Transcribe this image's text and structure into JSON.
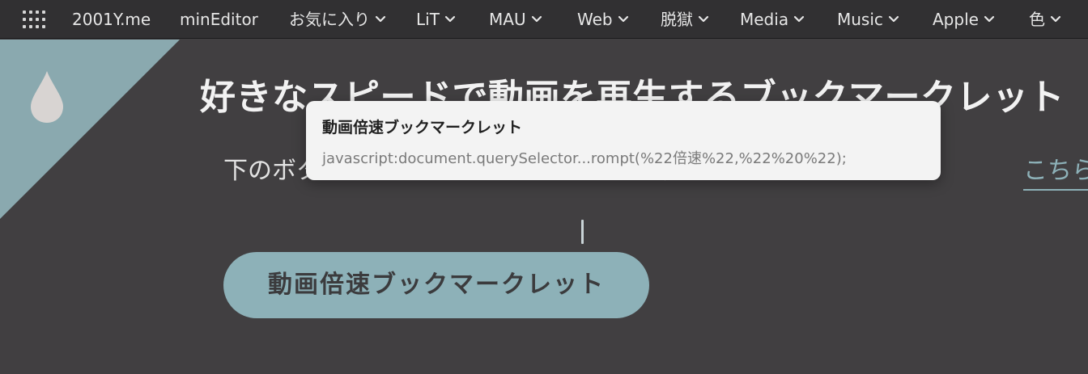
{
  "navbar": {
    "items": [
      {
        "label": "2001Y.me",
        "has_menu": false
      },
      {
        "label": "minEditor",
        "has_menu": false
      },
      {
        "label": "お気に入り",
        "has_menu": true
      },
      {
        "label": "LiT",
        "has_menu": true
      },
      {
        "label": "MAU",
        "has_menu": true
      },
      {
        "label": "Web",
        "has_menu": true
      },
      {
        "label": "脱獄",
        "has_menu": true
      },
      {
        "label": "Media",
        "has_menu": true
      },
      {
        "label": "Music",
        "has_menu": true
      },
      {
        "label": "Apple",
        "has_menu": true
      },
      {
        "label": "色",
        "has_menu": true
      }
    ]
  },
  "main": {
    "headline": "好きなスピードで動画を再生するブックマークレット",
    "instruction": "下のボタンをブックマークバーにドラッグ&ドロップ。スマホは、",
    "instruction_link": "こちら",
    "bookmarklet_button": "動画倍速ブックマークレット"
  },
  "tooltip": {
    "title": "動画倍速ブックマークレット",
    "url": "javascript:document.querySelector...rompt(%22倍速%22,%22%20%22);"
  },
  "colors": {
    "background": "#413f41",
    "navbar": "#313032",
    "accent": "#8db1b8",
    "corner": "#8aa9af",
    "tooltip_bg": "#f3f3f3"
  },
  "icons": {
    "app_grid": "grid-menu-icon",
    "drop": "water-drop-icon",
    "menu_chevron": "chevron-down-icon"
  }
}
